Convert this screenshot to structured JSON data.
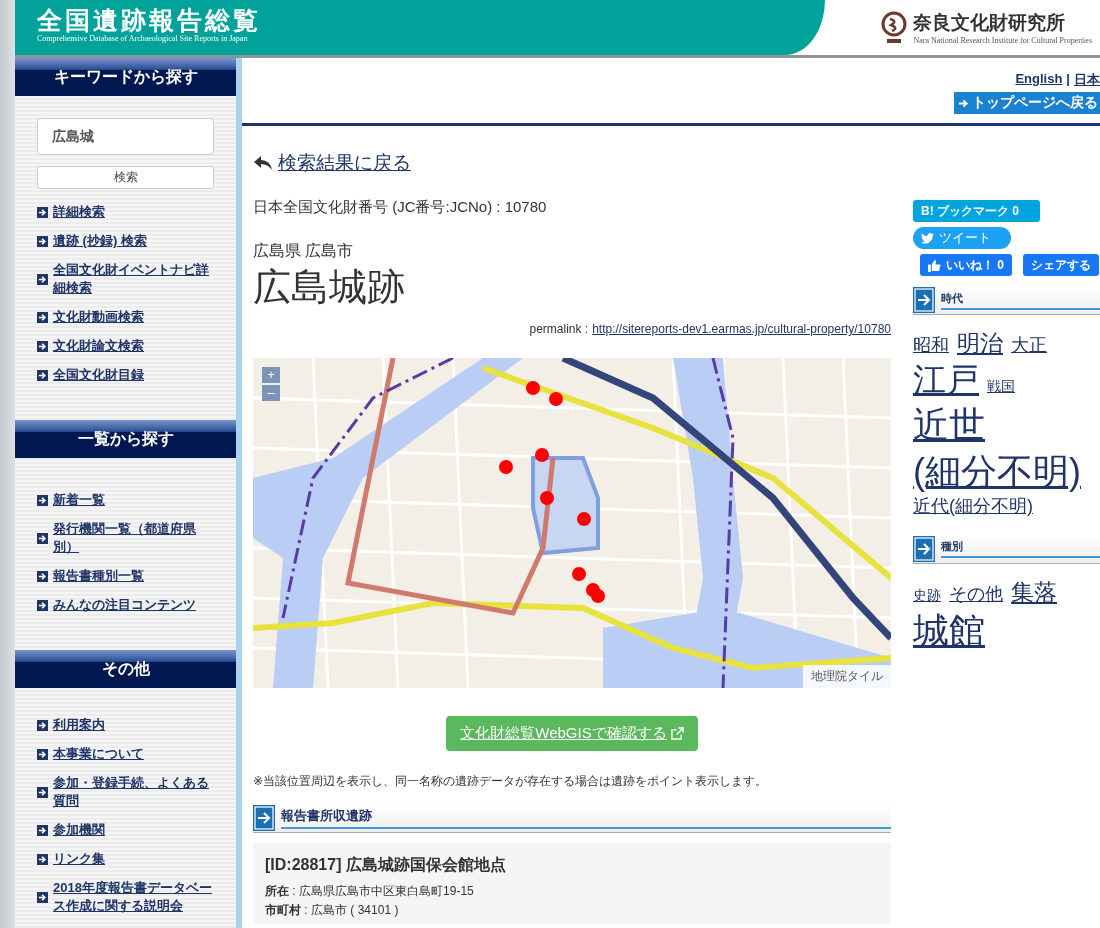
{
  "header": {
    "title": "全国遺跡報告総覧",
    "subtitle": "Comprehensive Database of Archaeological Site Reports in Japan",
    "org_name": "奈良文化財研究所",
    "org_subtitle": "Nara National Research Institute for Cultural Properties"
  },
  "sidebar": {
    "sections": [
      {
        "title": "キーワードから探す",
        "search": {
          "value": "広島城",
          "button": "検索"
        },
        "links": [
          "詳細検索",
          "遺跡 (抄録) 検索",
          "全国文化財イベントナビ詳細検索",
          "文化財動画検索",
          "文化財論文検索",
          "全国文化財目録"
        ]
      },
      {
        "title": "一覧から探す",
        "links": [
          "新着一覧",
          "発行機関一覧（都道府県別）",
          "報告書種別一覧",
          "みんなの注目コンテンツ"
        ]
      },
      {
        "title": "その他",
        "links": [
          "利用案内",
          "本事業について",
          "参加・登録手続、よくある質問",
          "参加機関",
          "リンク集",
          "2018年度報告書データベース作成に関する説明会"
        ]
      }
    ]
  },
  "top_nav": {
    "languages": [
      "English",
      "日本"
    ],
    "separator": "|",
    "top_button": "トップページへ戻る"
  },
  "back_link": "検索結果に戻る",
  "jc_number": "日本全国文化財番号 (JC番号:JCNo) : 10780",
  "location": "広島県 広島市",
  "title": "広島城跡",
  "permalink": {
    "label": "permalink :",
    "url": "http://sitereports-dev1.earmas.jp/cultural-property/10780"
  },
  "map": {
    "zoom_in": "+",
    "zoom_out": "–",
    "attribution": "地理院タイル"
  },
  "webgis_button": "文化財総覧WebGISで確認する",
  "note": "※当該位置周辺を表示し、同一名称の遺跡データが存在する場合は遺跡をポイント表示します。",
  "section": {
    "title": "報告書所収遺跡"
  },
  "site": {
    "title": "[ID:28817] 広島城跡国保会館地点",
    "fields": [
      {
        "label": "所在",
        "separator": ":",
        "value": "広島県広島市中区東白島町19-15"
      },
      {
        "label": "市町村",
        "separator": ":",
        "value": "広島市 ( 34101 )"
      }
    ]
  },
  "social": [
    {
      "kind": "hatena",
      "logo": "B!",
      "label": "ブックマーク",
      "count": "0"
    },
    {
      "kind": "twitter",
      "label": "ツイート"
    },
    {
      "kind": "like",
      "label": "いいね！",
      "count": "0"
    },
    {
      "kind": "share",
      "label": "シェアする"
    }
  ],
  "tag_groups": [
    {
      "title": "時代",
      "tags": [
        {
          "label": "昭和",
          "kind": "small"
        },
        {
          "label": "明治",
          "kind": "medium"
        },
        {
          "label": "大正",
          "kind": "small"
        },
        {
          "label": "江戸",
          "kind": "large"
        },
        {
          "label": "戦国",
          "kind": "tiny"
        },
        {
          "label": "近世(細分不明)",
          "kind": "huge"
        },
        {
          "label": "近代(細分不明)",
          "kind": "small"
        }
      ]
    },
    {
      "title": "種別",
      "tags": [
        {
          "label": "史跡",
          "kind": "tiny"
        },
        {
          "label": "その他",
          "kind": "small"
        },
        {
          "label": "集落",
          "kind": "medium"
        },
        {
          "label": "城館",
          "kind": "huge"
        }
      ]
    }
  ]
}
